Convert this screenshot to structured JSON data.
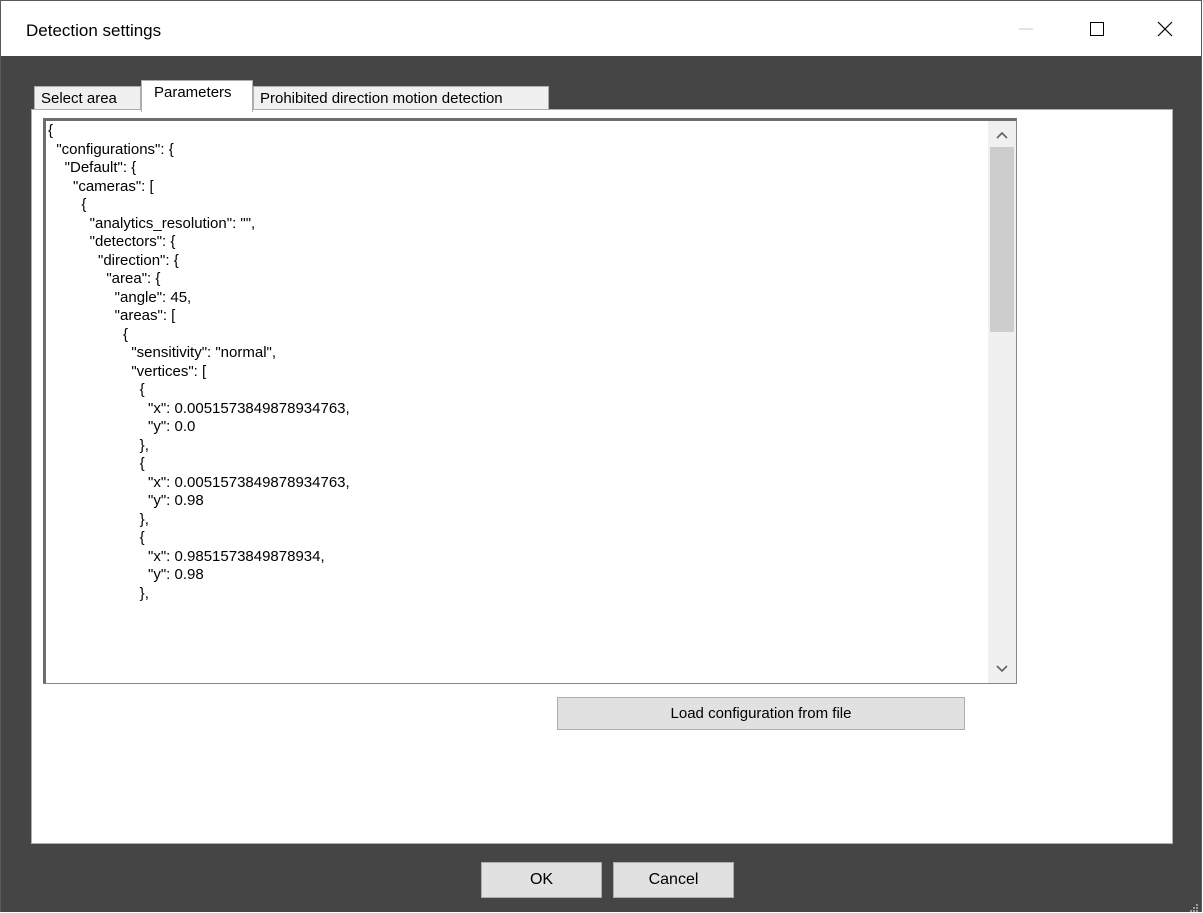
{
  "window": {
    "title": "Detection settings"
  },
  "tabs": [
    {
      "label": "Select area"
    },
    {
      "label": "Parameters"
    },
    {
      "label": "Prohibited direction motion detection"
    }
  ],
  "editor": {
    "content": "{\n  \"configurations\": {\n    \"Default\": {\n      \"cameras\": [\n        {\n          \"analytics_resolution\": \"\",\n          \"detectors\": {\n            \"direction\": {\n              \"area\": {\n                \"angle\": 45,\n                \"areas\": [\n                  {\n                    \"sensitivity\": \"normal\",\n                    \"vertices\": [\n                      {\n                        \"x\": 0.0051573849878934763,\n                        \"y\": 0.0\n                      },\n                      {\n                        \"x\": 0.0051573849878934763,\n                        \"y\": 0.98\n                      },\n                      {\n                        \"x\": 0.9851573849878934,\n                        \"y\": 0.98\n                      },"
  },
  "buttons": {
    "load": "Load configuration from file",
    "ok": "OK",
    "cancel": "Cancel"
  },
  "icons": {
    "minimize": "minimize-icon",
    "maximize": "maximize-icon",
    "close": "close-icon",
    "scroll_up": "chevron-up-icon",
    "scroll_down": "chevron-down-icon",
    "resize_grip": "resize-grip-icon"
  },
  "colors": {
    "frame_background": "#454545",
    "panel_background": "#ffffff",
    "button_face": "#e1e1e1"
  }
}
